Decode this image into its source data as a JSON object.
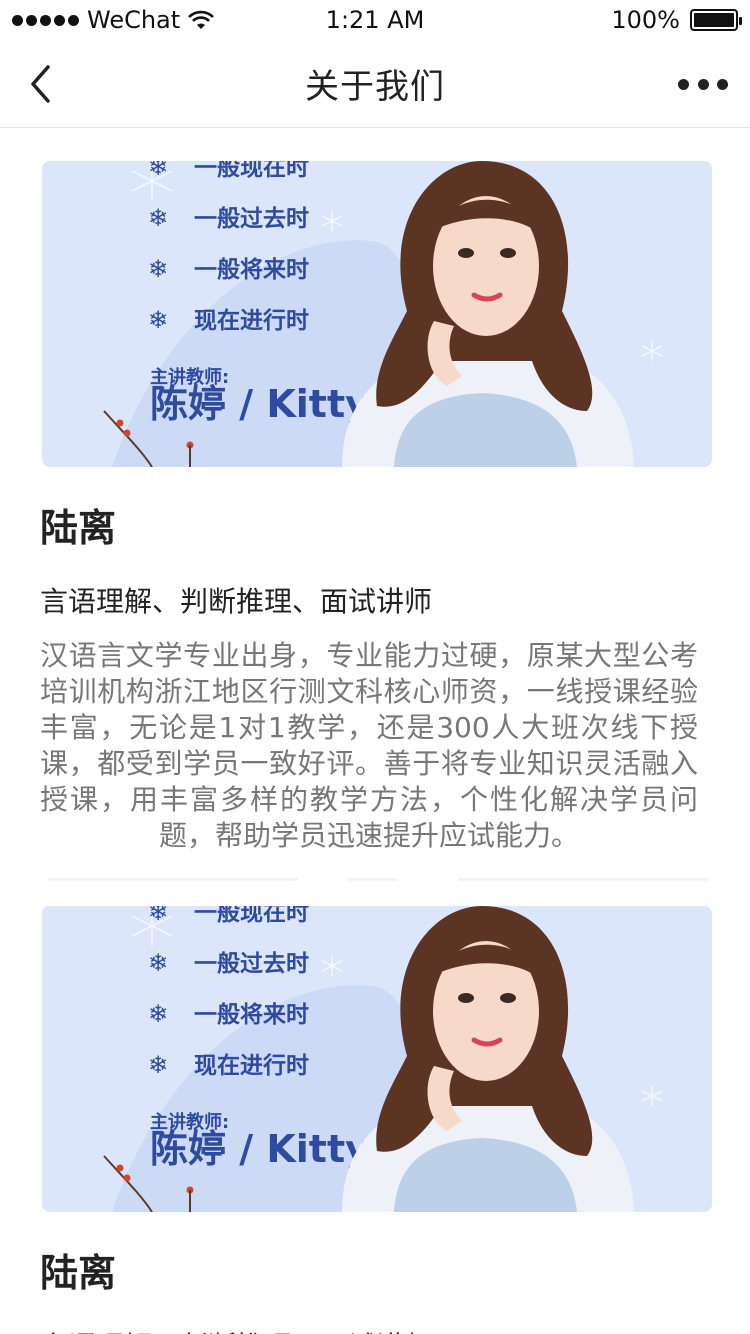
{
  "status_bar": {
    "carrier": "WeChat",
    "time": "1:21 AM",
    "battery": "100%"
  },
  "nav": {
    "title": "关于我们"
  },
  "banner": {
    "topics": [
      "一般现在时",
      "一般过去时",
      "一般将来时",
      "现在进行时"
    ],
    "teacher_label": "主讲教师:",
    "teacher_name": "陈婷 / Kitty",
    "bg_color": "#dbe6fb",
    "text_color": "#2f4ba0"
  },
  "cards": [
    {
      "name": "陆离",
      "role": "言语理解、判断推理、面试讲师",
      "bio": "汉语言文学专业出身，专业能力过硬，原某大型公考培训机构浙江地区行测文科核心师资，一线授课经验丰富，无论是1对1教学，还是300人大班次线下授课，都受到学员一致好评。善于将专业知识灵活融入授课，用丰富多样的教学方法，个性化解决学员问题，帮助学员迅速提升应试能力。"
    },
    {
      "name": "陆离",
      "role": "言语理解、判断推理、面试讲师",
      "bio": ""
    }
  ]
}
